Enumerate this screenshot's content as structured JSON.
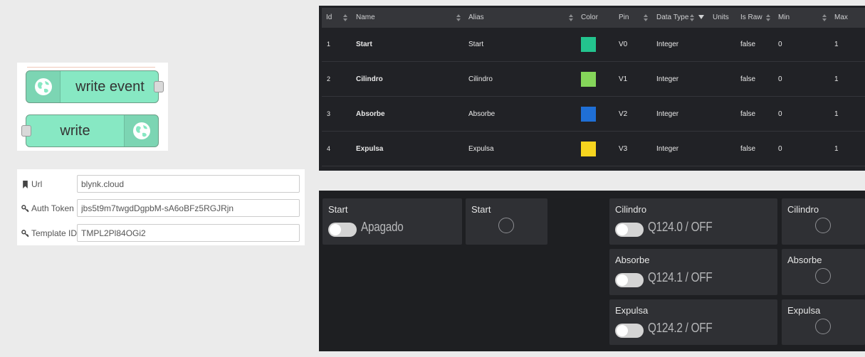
{
  "nodes": {
    "write_event_label": "write event",
    "write_label": "write"
  },
  "config": {
    "url": {
      "label": "Url",
      "value": "blynk.cloud"
    },
    "auth_token": {
      "label": "Auth Token",
      "value": "jbs5t9m7twgdDgpbM-sA6oBFz5RGJRjn"
    },
    "template_id": {
      "label": "Template ID",
      "value": "TMPL2Pl84OGi2"
    }
  },
  "table": {
    "headers": [
      "Id",
      "Name",
      "Alias",
      "Color",
      "Pin",
      "Data Type",
      "Units",
      "Is Raw",
      "Min",
      "Max"
    ],
    "rows": [
      {
        "id": "1",
        "name": "Start",
        "alias": "Start",
        "color": "#23c48e",
        "pin": "V0",
        "data_type": "Integer",
        "units": "",
        "is_raw": "false",
        "min": "0",
        "max": "1"
      },
      {
        "id": "2",
        "name": "Cilindro",
        "alias": "Cilindro",
        "color": "#85d65a",
        "pin": "V1",
        "data_type": "Integer",
        "units": "",
        "is_raw": "false",
        "min": "0",
        "max": "1"
      },
      {
        "id": "3",
        "name": "Absorbe",
        "alias": "Absorbe",
        "color": "#1f6fd6",
        "pin": "V2",
        "data_type": "Integer",
        "units": "",
        "is_raw": "false",
        "min": "0",
        "max": "1"
      },
      {
        "id": "4",
        "name": "Expulsa",
        "alias": "Expulsa",
        "color": "#f7d51f",
        "pin": "V3",
        "data_type": "Integer",
        "units": "",
        "is_raw": "false",
        "min": "0",
        "max": "1"
      }
    ]
  },
  "dashboard": {
    "start_switch": {
      "title": "Start",
      "state": "Apagado"
    },
    "start_led": {
      "title": "Start"
    },
    "cilindro_switch": {
      "title": "Cilindro",
      "state": "Q124.0 / OFF"
    },
    "cilindro_led": {
      "title": "Cilindro"
    },
    "absorbe_switch": {
      "title": "Absorbe",
      "state": "Q124.1 / OFF"
    },
    "absorbe_led": {
      "title": "Absorbe"
    },
    "expulsa_switch": {
      "title": "Expulsa",
      "state": "Q124.2 / OFF"
    },
    "expulsa_led": {
      "title": "Expulsa"
    }
  },
  "icons": {
    "node_icon": "globe-icon",
    "url_icon": "bookmark-icon",
    "key_icon": "key-icon"
  }
}
